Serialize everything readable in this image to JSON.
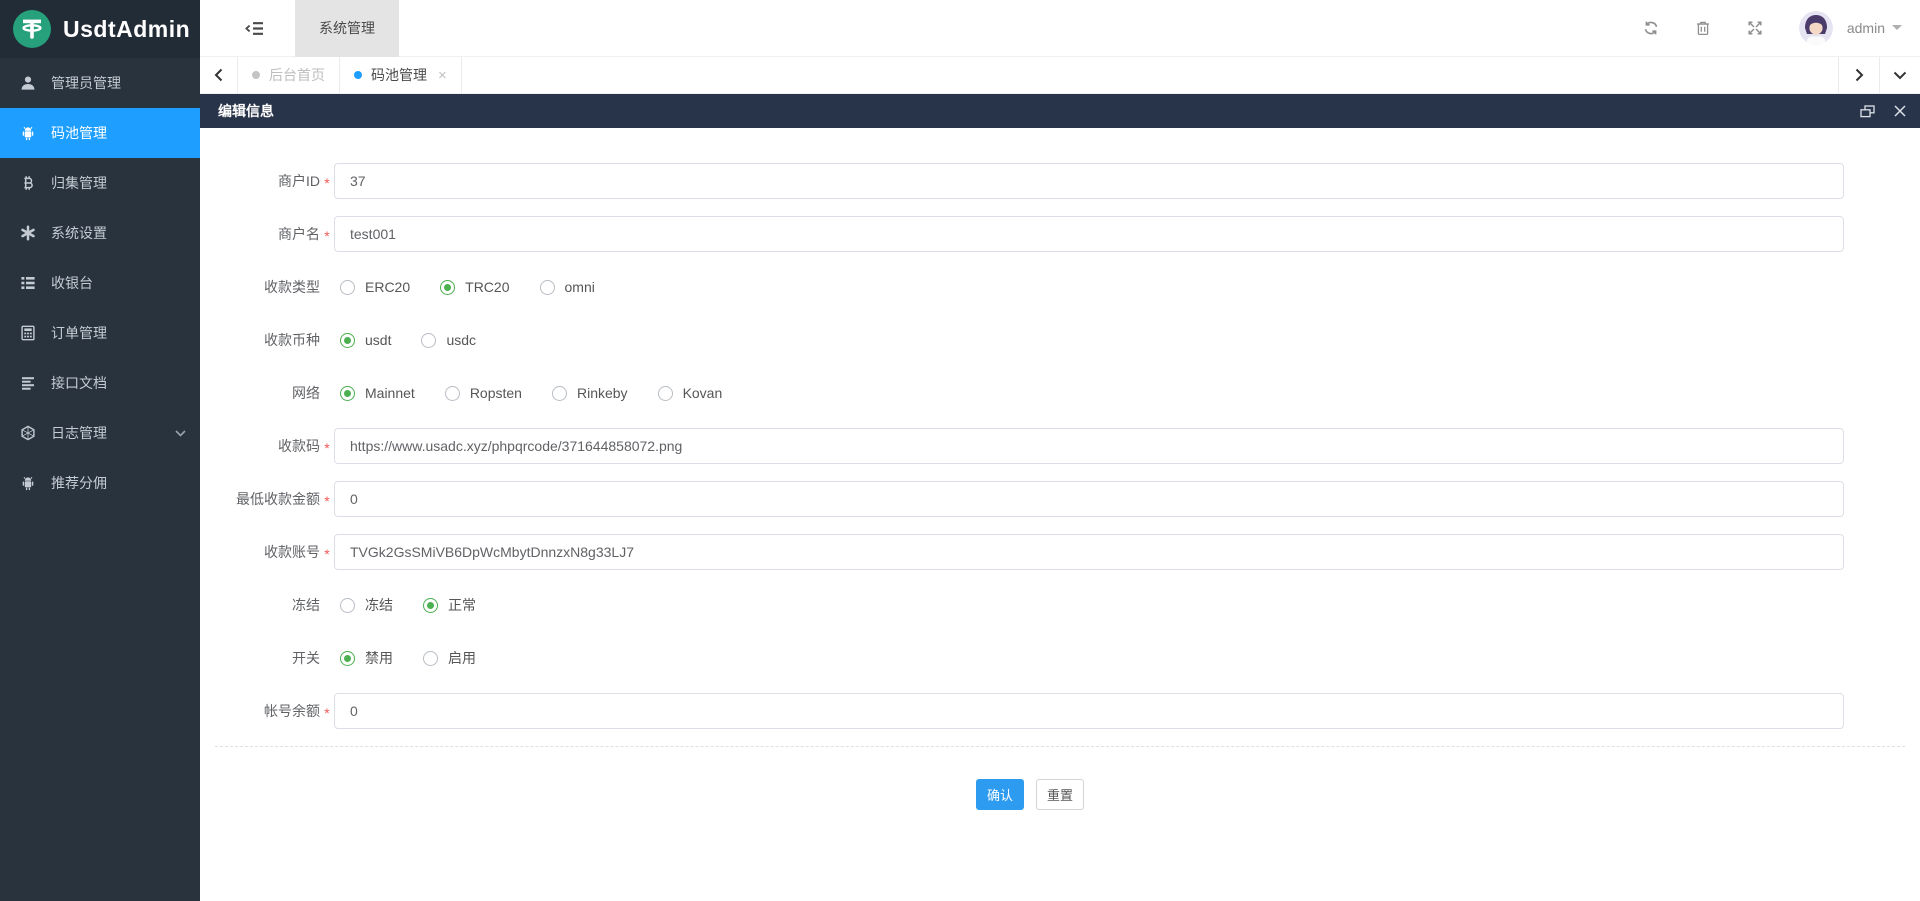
{
  "app": {
    "title": "UsdtAdmin",
    "logo_icon": "tether-icon"
  },
  "colors": {
    "accent": "#1E9FFF",
    "sidebar-bg": "#28333E",
    "logo-bg": "#222C37",
    "panel-header-bg": "#283449",
    "radio-green": "#4CAF50",
    "confirm-blue": "#2D9CF0",
    "required-red": "#F25757"
  },
  "topbar": {
    "nav_tab": "系统管理",
    "user": "admin",
    "icons": [
      "collapse-menu-icon",
      "refresh-icon",
      "trash-icon",
      "fullscreen-icon",
      "caret-down-icon"
    ]
  },
  "tabs": {
    "items": [
      {
        "key": "home",
        "label": "后台首页",
        "active": false,
        "closable": false
      },
      {
        "key": "pool",
        "label": "码池管理",
        "active": true,
        "closable": true
      }
    ]
  },
  "sidebar": {
    "items": [
      {
        "key": "admin-management",
        "label": "管理员管理",
        "icon": "user-icon",
        "active": false,
        "expandable": false
      },
      {
        "key": "pool-management",
        "label": "码池管理",
        "icon": "android-icon",
        "active": true,
        "expandable": false
      },
      {
        "key": "collect-management",
        "label": "归集管理",
        "icon": "bitcoin-icon",
        "active": false,
        "expandable": false
      },
      {
        "key": "system-settings",
        "label": "系统设置",
        "icon": "asterisk-icon",
        "active": false,
        "expandable": false
      },
      {
        "key": "cashier",
        "label": "收银台",
        "icon": "list-icon",
        "active": false,
        "expandable": false
      },
      {
        "key": "order-management",
        "label": "订单管理",
        "icon": "calculator-icon",
        "active": false,
        "expandable": false
      },
      {
        "key": "api-docs",
        "label": "接口文档",
        "icon": "doc-lines-icon",
        "active": false,
        "expandable": false
      },
      {
        "key": "log-management",
        "label": "日志管理",
        "icon": "hexagon-icon",
        "active": false,
        "expandable": true
      },
      {
        "key": "referral-commission",
        "label": "推荐分佣",
        "icon": "android-icon",
        "active": false,
        "expandable": false
      }
    ]
  },
  "panel": {
    "title": "编辑信息",
    "tools": [
      "restore-window-icon",
      "close-icon"
    ]
  },
  "form": {
    "rows": [
      {
        "key": "merchant-id",
        "type": "input",
        "label": "商户ID",
        "required": true,
        "value": "37"
      },
      {
        "key": "merchant-name",
        "type": "input",
        "label": "商户名",
        "required": true,
        "value": "test001"
      },
      {
        "key": "payment-type",
        "type": "radio",
        "label": "收款类型",
        "required": false,
        "options": [
          "ERC20",
          "TRC20",
          "omni"
        ],
        "selected": 1
      },
      {
        "key": "payment-currency",
        "type": "radio",
        "label": "收款币种",
        "required": false,
        "options": [
          "usdt",
          "usdc"
        ],
        "selected": 0
      },
      {
        "key": "network",
        "type": "radio",
        "label": "网络",
        "required": false,
        "options": [
          "Mainnet",
          "Ropsten",
          "Rinkeby",
          "Kovan"
        ],
        "selected": 0
      },
      {
        "key": "payment-code",
        "type": "input",
        "label": "收款码",
        "required": true,
        "value": "https://www.usadc.xyz/phpqrcode/371644858072.png"
      },
      {
        "key": "min-amount",
        "type": "input",
        "label": "最低收款金额",
        "required": true,
        "value": "0"
      },
      {
        "key": "payment-account",
        "type": "input",
        "label": "收款账号",
        "required": true,
        "value": "TVGk2GsSMiVB6DpWcMbytDnnzxN8g33LJ7"
      },
      {
        "key": "freeze",
        "type": "radio",
        "label": "冻结",
        "required": false,
        "options": [
          "冻结",
          "正常"
        ],
        "selected": 1
      },
      {
        "key": "switch",
        "type": "radio",
        "label": "开关",
        "required": false,
        "options": [
          "禁用",
          "启用"
        ],
        "selected": 0
      },
      {
        "key": "account-balance",
        "type": "input",
        "label": "帐号余额",
        "required": true,
        "value": "0"
      }
    ],
    "buttons": {
      "confirm": "确认",
      "reset": "重置"
    }
  }
}
